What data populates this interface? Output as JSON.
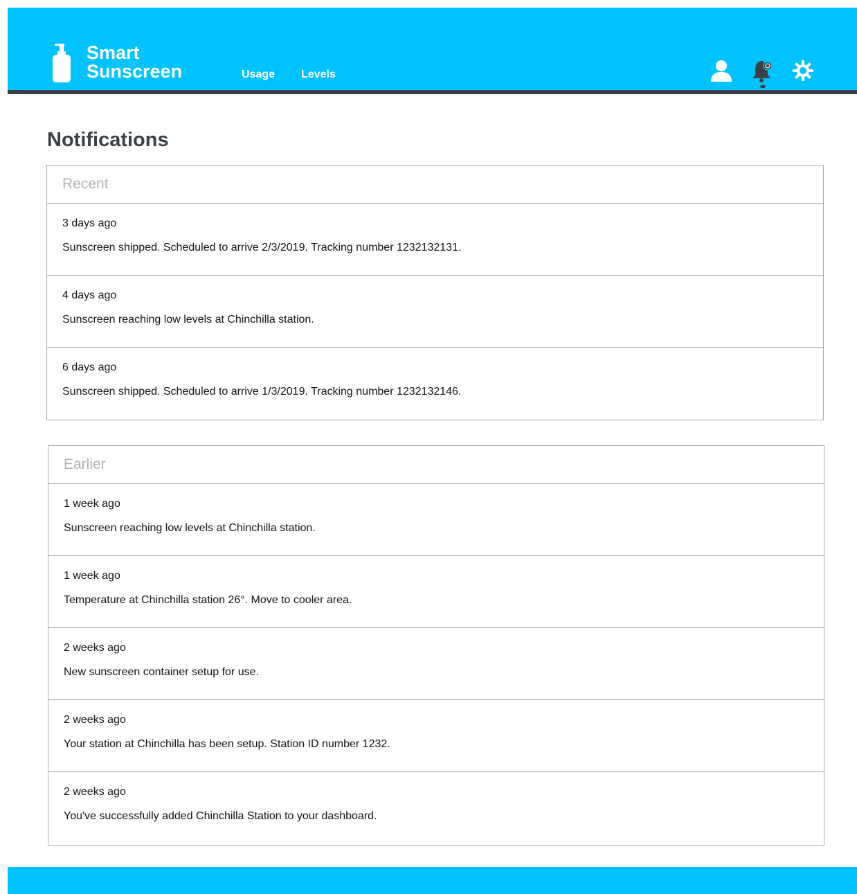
{
  "header": {
    "brand_line1": "Smart",
    "brand_line2": "Sunscreen",
    "logo_icon": "sunscreen-bottle-icon",
    "nav": [
      {
        "label": "Usage"
      },
      {
        "label": "Levels"
      }
    ],
    "icons": [
      "user-icon",
      "bell-icon",
      "gear-icon"
    ],
    "accent_color": "#00c2ff",
    "bar_color": "#3a4146"
  },
  "page_title": "Notifications",
  "sections": [
    {
      "title": "Recent",
      "items": [
        {
          "when": "3 days ago",
          "message": "Sunscreen shipped. Scheduled to arrive 2/3/2019. Tracking number 1232132131."
        },
        {
          "when": "4 days ago",
          "message": "Sunscreen reaching low levels at Chinchilla station."
        },
        {
          "when": "6 days ago",
          "message": "Sunscreen shipped. Scheduled to arrive 1/3/2019. Tracking number 1232132146."
        }
      ]
    },
    {
      "title": "Earlier",
      "items": [
        {
          "when": "1 week ago",
          "message": "Sunscreen reaching low levels at Chinchilla station."
        },
        {
          "when": "1 week ago",
          "message": "Temperature at Chinchilla station 26°. Move to cooler area."
        },
        {
          "when": "2 weeks ago",
          "message": "New sunscreen container setup for use."
        },
        {
          "when": "2 weeks ago",
          "message": "Your station at Chinchilla has been setup. Station ID number 1232."
        },
        {
          "when": "2 weeks ago",
          "message": "You've successfully added Chinchilla Station to your dashboard."
        }
      ]
    }
  ]
}
